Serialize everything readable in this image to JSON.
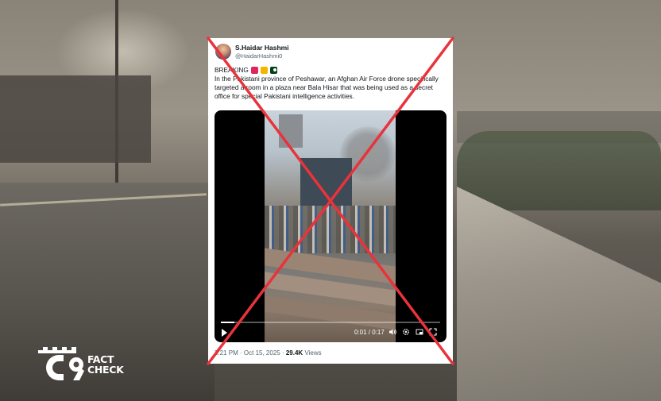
{
  "tweet": {
    "author_name": "S.Haidar Hashmi",
    "author_handle": "@HaidarHashmi0",
    "breaking_label": "BREAKING",
    "emoji_icons": [
      "siren-icon",
      "lock-icon",
      "pakistan-flag-icon"
    ],
    "body": "In the Pakistani province of Peshawar, an Afghan Air Force drone specifically targeted a room in a plaza near Bala Hisar that was being used as a secret office for special Pakistani intelligence activities.",
    "video": {
      "timecode": "0:01 / 0:17",
      "progress": 0.06,
      "controls": [
        "play-icon",
        "volume-icon",
        "settings-icon",
        "pip-icon",
        "fullscreen-icon"
      ]
    },
    "timestamp": "3:21 PM · Oct 15, 2025",
    "separator": "·",
    "views_count": "29.4K",
    "views_label": "Views"
  },
  "overlay": {
    "mark": "red-x-icon",
    "color": "#e8333b"
  },
  "logo": {
    "line1": "FACT",
    "line2": "CHECK",
    "icon": "c9-logo-icon"
  }
}
